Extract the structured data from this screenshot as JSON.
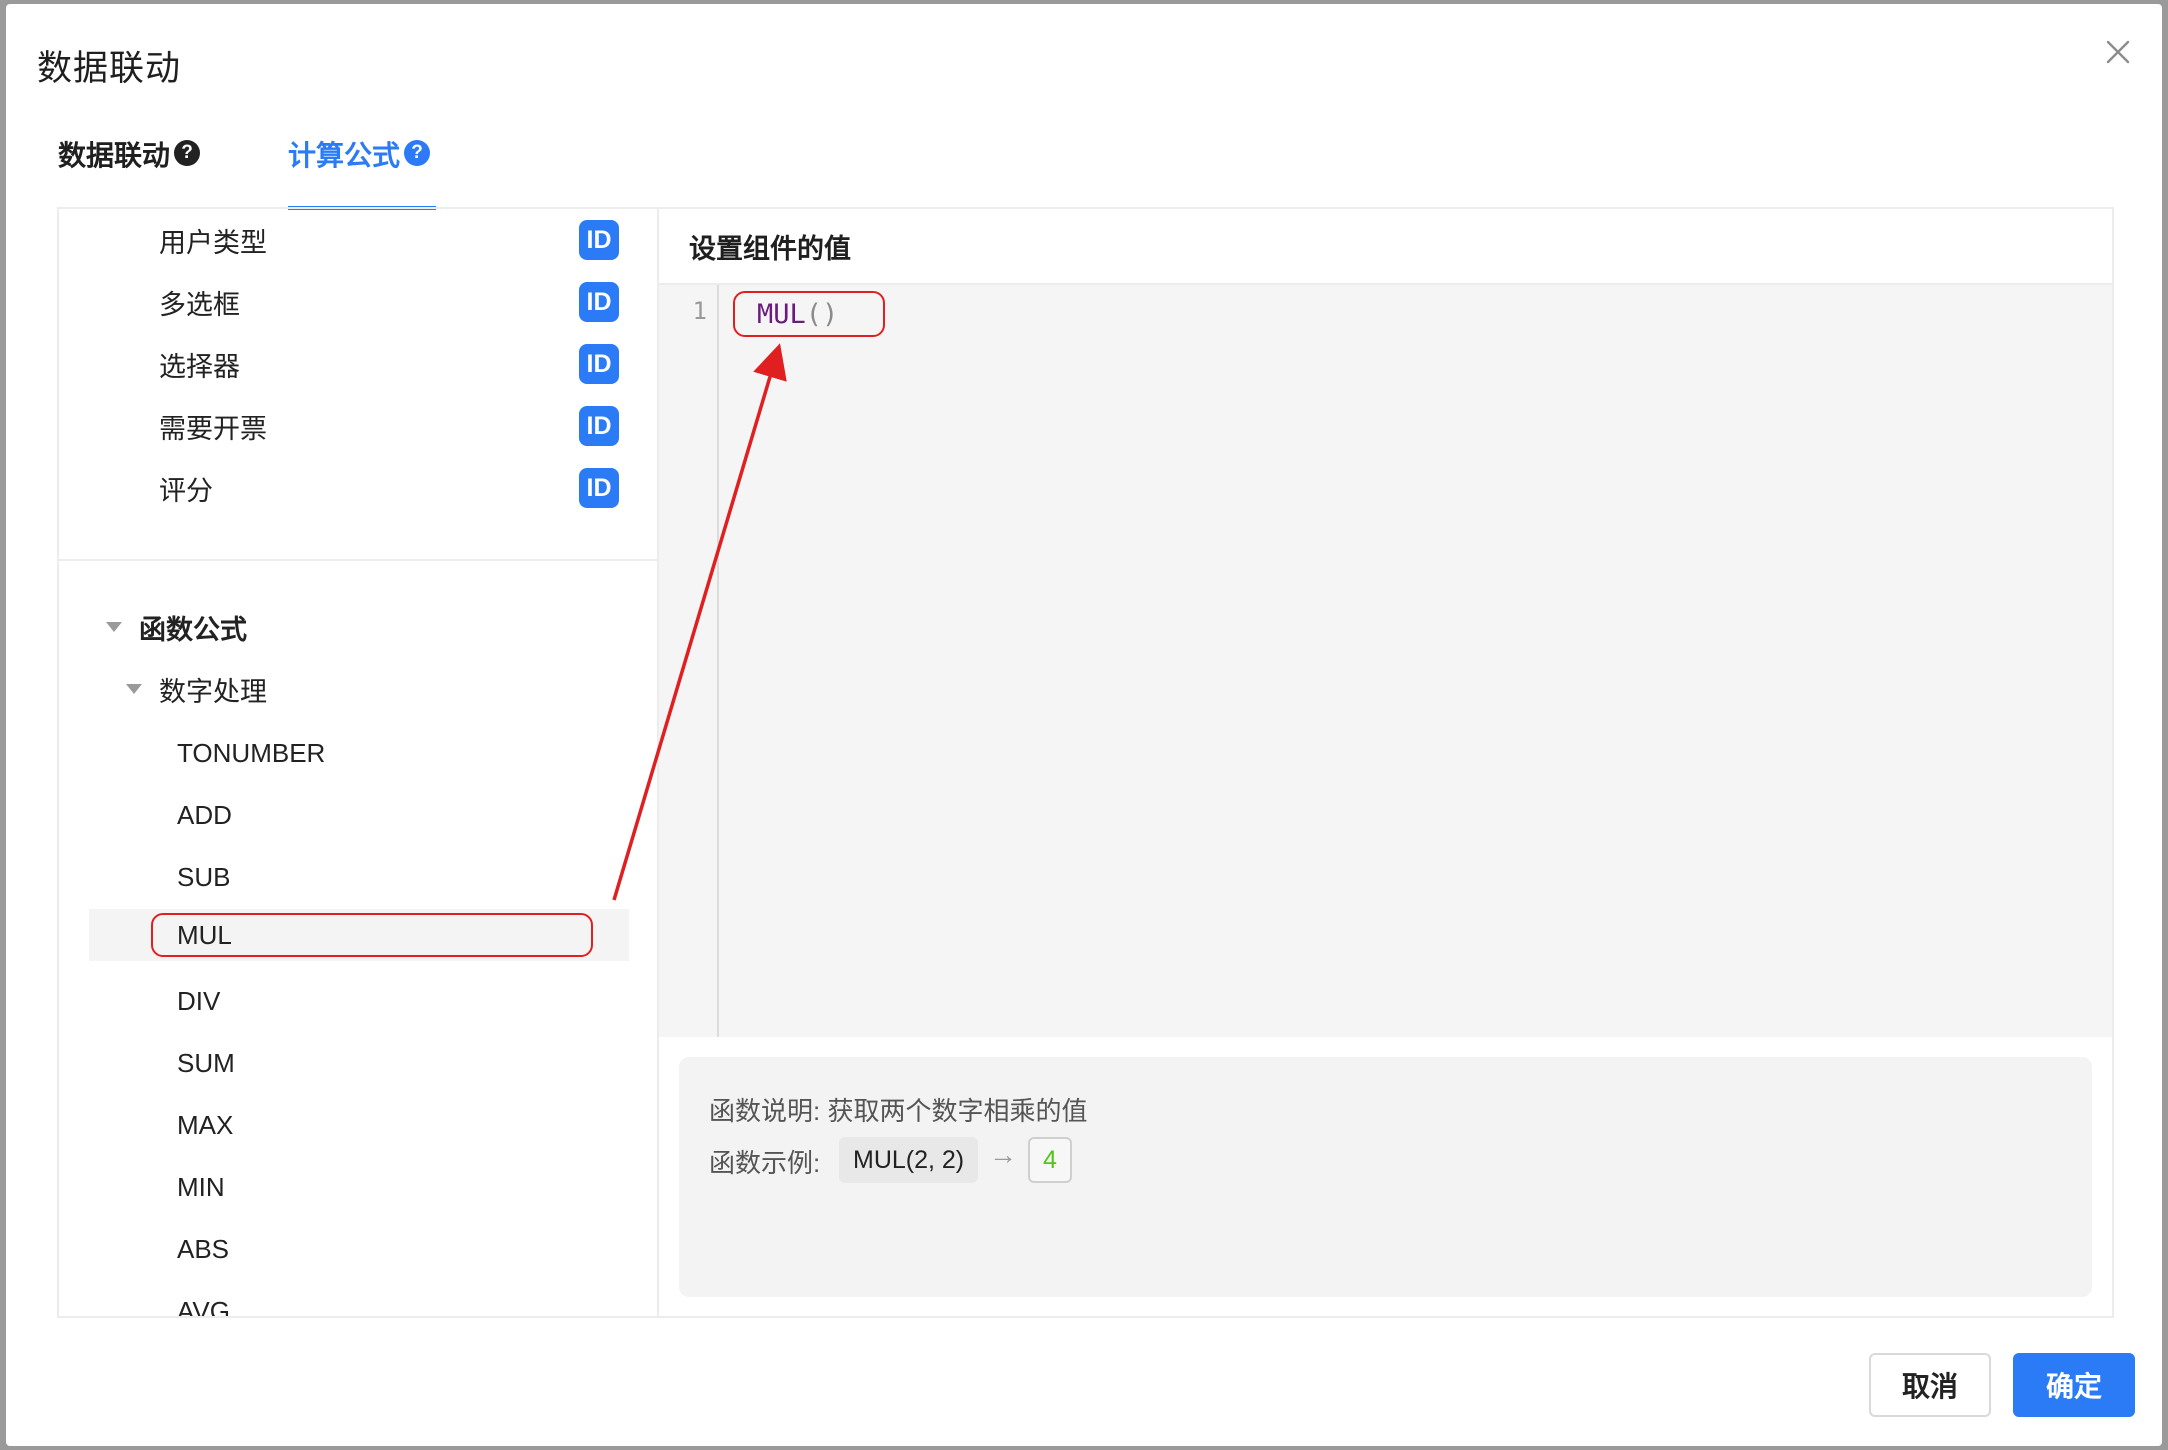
{
  "dialog": {
    "title": "数据联动"
  },
  "tabs": [
    {
      "label": "数据联动",
      "help": "?"
    },
    {
      "label": "计算公式",
      "help": "?"
    }
  ],
  "fields": [
    {
      "label": "用户类型",
      "badge": "ID"
    },
    {
      "label": "多选框",
      "badge": "ID"
    },
    {
      "label": "选择器",
      "badge": "ID"
    },
    {
      "label": "需要开票",
      "badge": "ID"
    },
    {
      "label": "评分",
      "badge": "ID"
    }
  ],
  "tree": {
    "root": "函数公式",
    "group": "数字处理",
    "functions": [
      "TONUMBER",
      "ADD",
      "SUB",
      "MUL",
      "DIV",
      "SUM",
      "MAX",
      "MIN",
      "ABS",
      "AVG"
    ],
    "selected": "MUL"
  },
  "editor": {
    "header": "设置组件的值",
    "line_number": "1",
    "code_fn": "MUL",
    "code_parens": "()"
  },
  "info": {
    "description": "函数说明: 获取两个数字相乘的值",
    "example_label": "函数示例:",
    "example_expr": "MUL(2, 2)",
    "example_arrow": "→",
    "example_result": "4"
  },
  "footer": {
    "cancel_label": "取消",
    "ok_label": "确定"
  },
  "colors": {
    "accent": "#2a7bf5",
    "annotation": "#e02020",
    "result": "#52c41a"
  }
}
